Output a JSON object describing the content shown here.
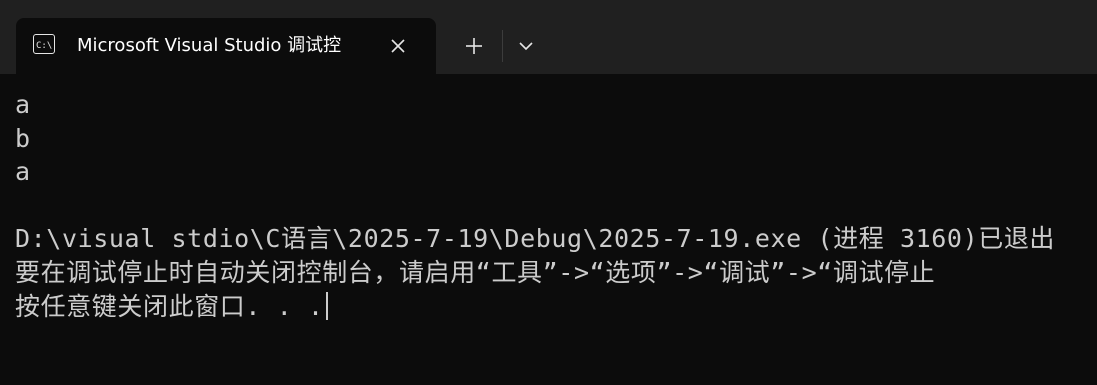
{
  "tab": {
    "title": "Microsoft Visual Studio 调试控",
    "icon": "console-icon"
  },
  "controls": {
    "close_icon": "close-icon",
    "new_tab_icon": "plus-icon",
    "dropdown_icon": "chevron-down-icon"
  },
  "terminal": {
    "lines": [
      "a",
      "b",
      "a",
      "",
      "D:\\visual stdio\\C语言\\2025-7-19\\Debug\\2025-7-19.exe (进程 3160)已退出",
      "要在调试停止时自动关闭控制台，请启用“工具”->“选项”->“调试”->“调试停止",
      "按任意键关闭此窗口. . ."
    ]
  },
  "colors": {
    "background": "#0c0c0c",
    "tabbar": "#202020",
    "text": "#cccccc",
    "tab_text": "#ffffff"
  }
}
